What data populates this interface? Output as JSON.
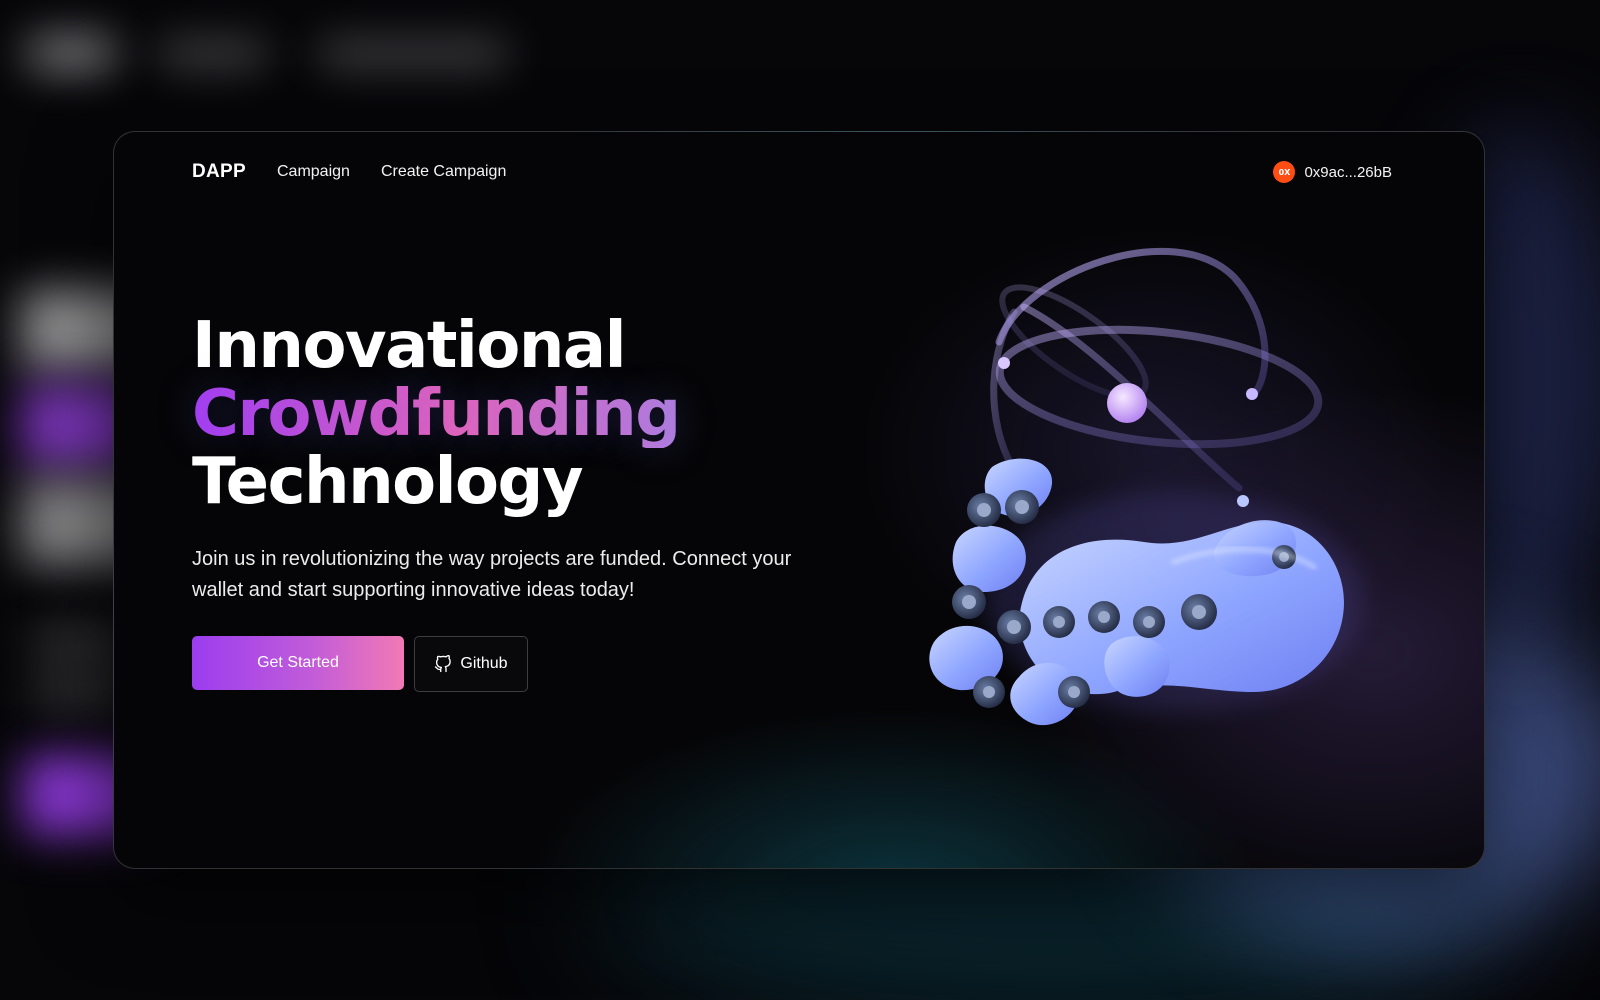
{
  "nav": {
    "brand": "DAPP",
    "links": [
      "Campaign",
      "Create Campaign"
    ],
    "wallet": {
      "avatar_text": "0X",
      "address": "0x9ac...26bB",
      "avatar_color": "#ff4d14"
    }
  },
  "hero": {
    "title_line1": "Innovational",
    "title_line2": "Crowdfunding",
    "title_line3": "Technology",
    "subtitle": "Join us in revolutionizing the way projects are funded. Connect your wallet and start supporting innovative ideas today!",
    "primary_button": "Get Started",
    "secondary_button": "Github",
    "secondary_icon": "github-icon"
  },
  "colors": {
    "background": "#050507",
    "gradient_start": "#a43cf0",
    "gradient_mid": "#e764b8",
    "gradient_end": "#5d9bf5",
    "button_start": "#9b3df0",
    "button_end": "#f279b6"
  },
  "illustration": {
    "name": "3d-robot-hand-atom-illustration"
  }
}
